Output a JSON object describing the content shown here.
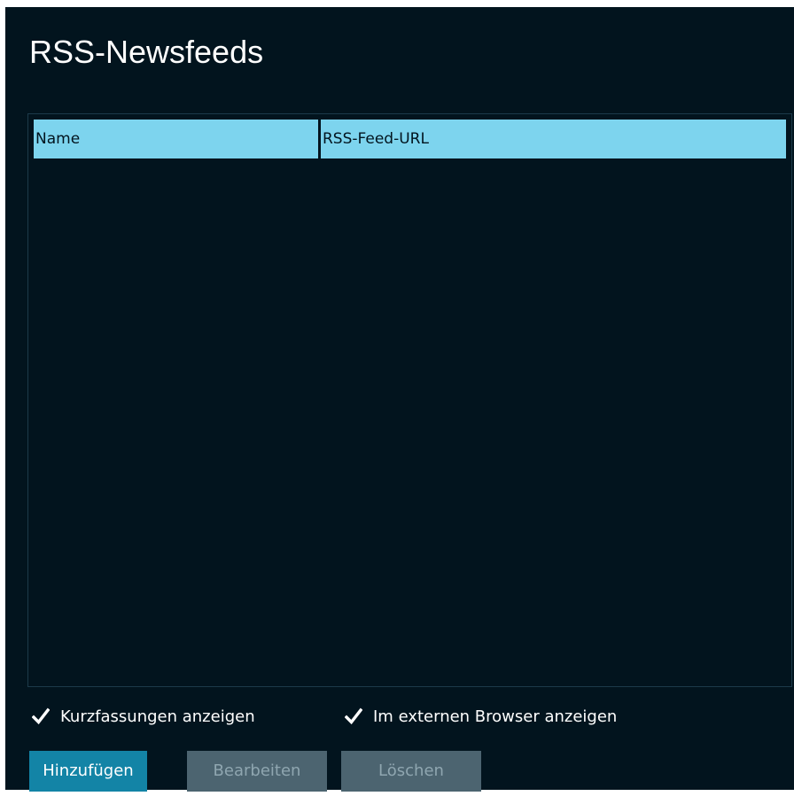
{
  "page": {
    "title": "RSS-Newsfeeds"
  },
  "table": {
    "columns": [
      {
        "label": "Name"
      },
      {
        "label": "RSS-Feed-URL"
      }
    ],
    "rows": []
  },
  "options": {
    "show_summaries": {
      "label": "Kurzfassungen anzeigen",
      "checked": true
    },
    "external_browser": {
      "label": "Im externen Browser anzeigen",
      "checked": true
    }
  },
  "buttons": {
    "add": {
      "label": "Hinzufügen",
      "enabled": true
    },
    "edit": {
      "label": "Bearbeiten",
      "enabled": false
    },
    "delete": {
      "label": "Löschen",
      "enabled": false
    }
  },
  "colors": {
    "background": "#02141e",
    "header": "#7dd4ee",
    "primary_button": "#1384a6",
    "disabled_button": "#4c6470"
  },
  "icons": {
    "checkbox": "check-icon"
  }
}
